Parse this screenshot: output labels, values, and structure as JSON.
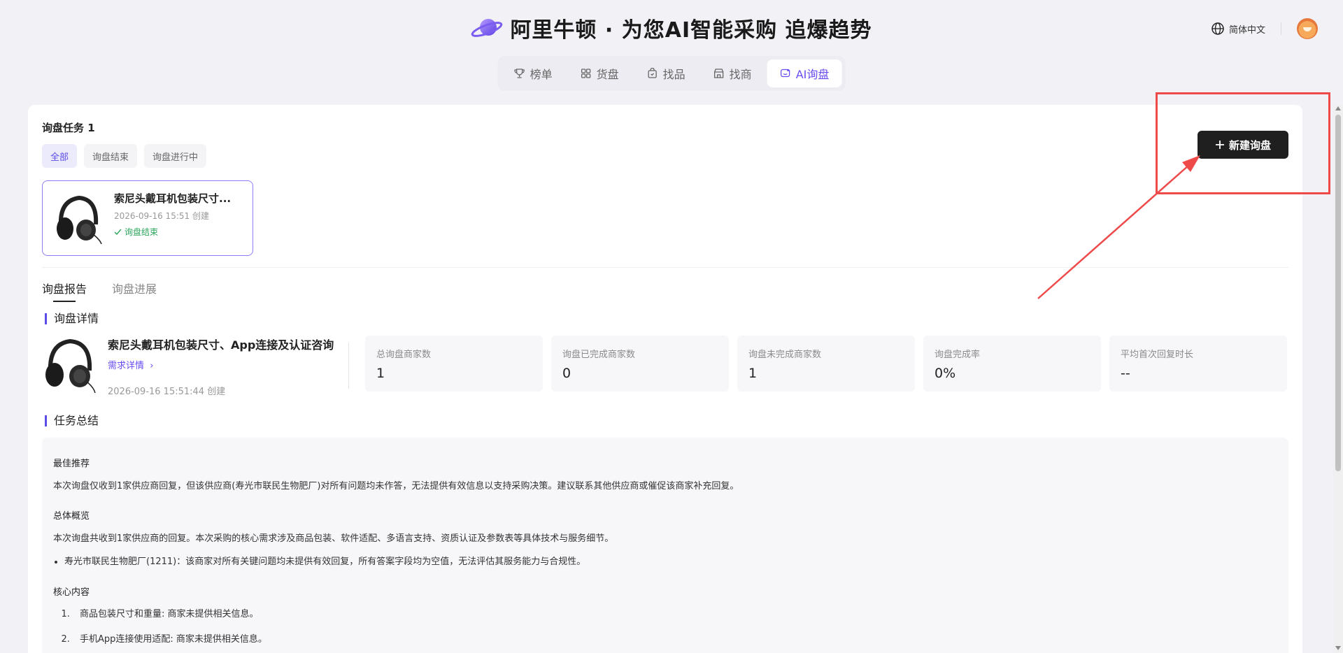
{
  "header": {
    "brand_title": "阿里牛顿 · 为您AI智能采购 追爆趋势",
    "language": "简体中文"
  },
  "nav": {
    "items": [
      {
        "label": "榜单",
        "icon": "trophy-icon"
      },
      {
        "label": "货盘",
        "icon": "grid-icon"
      },
      {
        "label": "找品",
        "icon": "bag-icon"
      },
      {
        "label": "找商",
        "icon": "store-icon"
      },
      {
        "label": "AI询盘",
        "icon": "chat-icon"
      }
    ],
    "active": "AI询盘"
  },
  "tasks": {
    "title": "询盘任务 1",
    "filters": [
      "全部",
      "询盘结束",
      "询盘进行中"
    ],
    "active_filter": "全部",
    "new_button": "新建询盘",
    "card": {
      "name": "索尼头戴耳机包装尺寸...",
      "created": "2026-09-16 15:51 创建",
      "status": "询盘结束"
    }
  },
  "report": {
    "tabs": [
      "询盘报告",
      "询盘进展"
    ],
    "active_tab": "询盘报告",
    "detail_heading": "询盘详情",
    "detail": {
      "name": "索尼头戴耳机包装尺寸、App连接及认证咨询",
      "link": "需求详情",
      "created": "2026-09-16 15:51:44 创建"
    },
    "stats": [
      {
        "label": "总询盘商家数",
        "value": "1"
      },
      {
        "label": "询盘已完成商家数",
        "value": "0"
      },
      {
        "label": "询盘未完成商家数",
        "value": "1"
      },
      {
        "label": "询盘完成率",
        "value": "0%"
      },
      {
        "label": "平均首次回复时长",
        "value": "--"
      }
    ],
    "summary_heading": "任务总结",
    "summary": {
      "best_title": "最佳推荐",
      "best_text": "本次询盘仅收到1家供应商回复，但该供应商(寿光市联民生物肥厂)对所有问题均未作答，无法提供有效信息以支持采购决策。建议联系其他供应商或催促该商家补充回复。",
      "overview_title": "总体概览",
      "overview_text": "本次询盘共收到1家供应商的回复。本次采购的核心需求涉及商品包装、软件适配、多语言支持、资质认证及参数表等具体技术与服务细节。",
      "overview_bullet": "寿光市联民生物肥厂(1211)：该商家对所有关键问题均未提供有效回复，所有答案字段均为空值，无法评估其服务能力与合规性。",
      "core_title": "核心内容",
      "core_items": [
        "商品包装尺寸和重量: 商家未提供相关信息。",
        "手机App连接使用适配: 商家未提供相关信息。"
      ]
    }
  },
  "colors": {
    "accent": "#6a4cf0",
    "annotation": "#ef4a4a",
    "success": "#2aa55a"
  }
}
